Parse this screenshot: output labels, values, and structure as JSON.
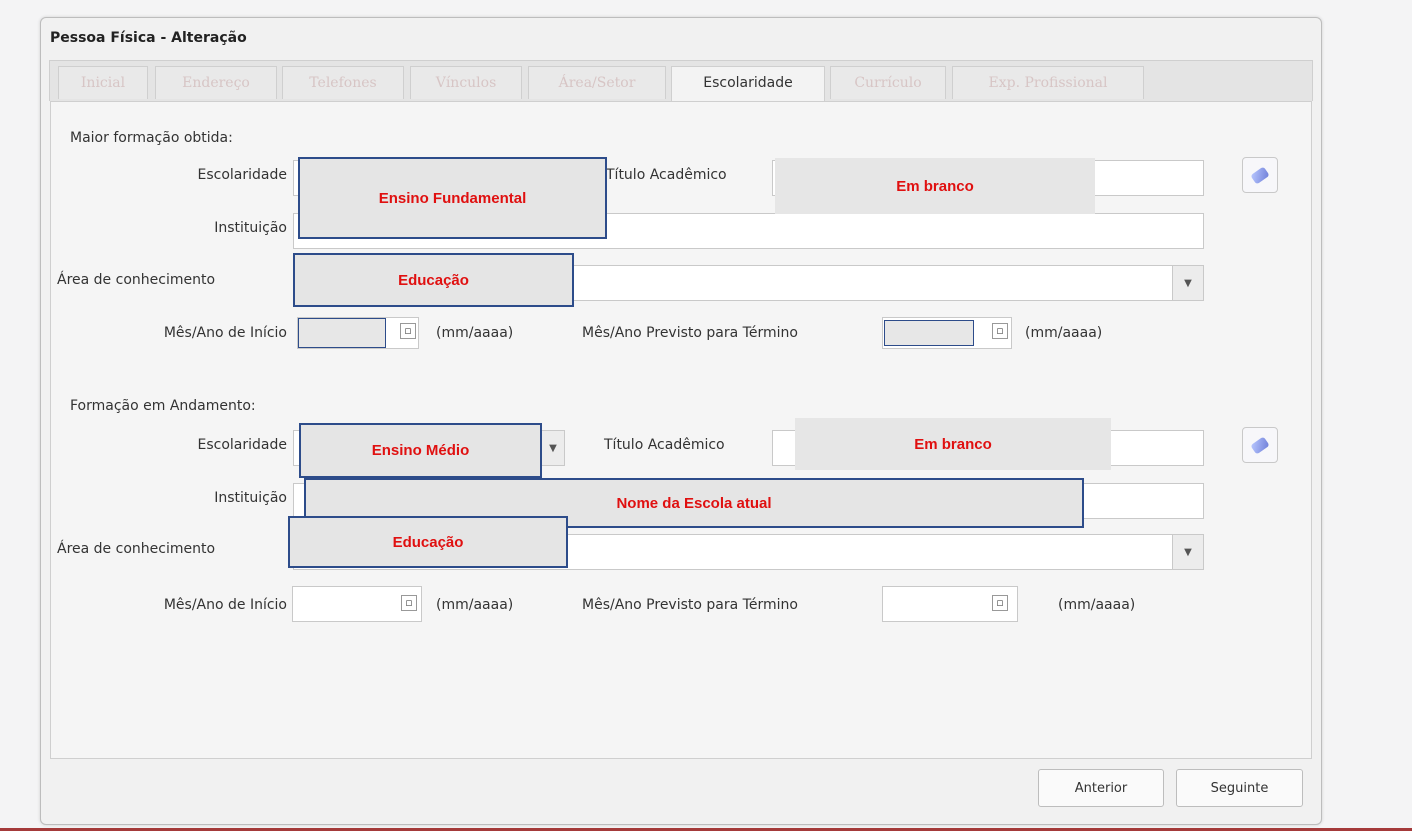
{
  "window": {
    "title": "Pessoa Física - Alteração"
  },
  "tabs": [
    {
      "label": "Inicial"
    },
    {
      "label": "Endereço"
    },
    {
      "label": "Telefones"
    },
    {
      "label": "Vínculos"
    },
    {
      "label": "Área/Setor"
    },
    {
      "label": "Escolaridade"
    },
    {
      "label": "Currículo"
    },
    {
      "label": "Exp. Profissional"
    }
  ],
  "section1": {
    "heading": "Maior formação obtida:",
    "escolaridade_label": "Escolaridade",
    "titulo_label": "Título Acadêmico",
    "instituicao_label": "Instituição",
    "area_label": "Área de conhecimento",
    "inicio_label": "Mês/Ano de Início",
    "termino_label": "Mês/Ano Previsto para Término",
    "format_hint": "(mm/aaaa)"
  },
  "section2": {
    "heading": "Formação em Andamento:",
    "escolaridade_label": "Escolaridade",
    "titulo_label": "Título Acadêmico",
    "instituicao_label": "Instituição",
    "area_label": "Área de conhecimento",
    "inicio_label": "Mês/Ano de Início",
    "termino_label": "Mês/Ano Previsto para Término",
    "format_hint": "(mm/aaaa)"
  },
  "annotations": {
    "s1_escolaridade": "Ensino Fundamental",
    "s1_titulo": "Em branco",
    "s1_area": "Educação",
    "s2_escolaridade": "Ensino Médio",
    "s2_titulo": "Em branco",
    "s2_instituicao": "Nome da Escola atual",
    "s2_area": "Educação"
  },
  "footer": {
    "prev_label": "Anterior",
    "next_label": "Seguinte"
  },
  "icons": {
    "eraser": "eraser-icon",
    "calendar": "calendar-icon",
    "dropdown": "chevron-down-icon"
  },
  "colors": {
    "annotation_text": "#e01010",
    "annotation_border": "#2d4c8a",
    "bottom_bar": "#a43a3a"
  }
}
